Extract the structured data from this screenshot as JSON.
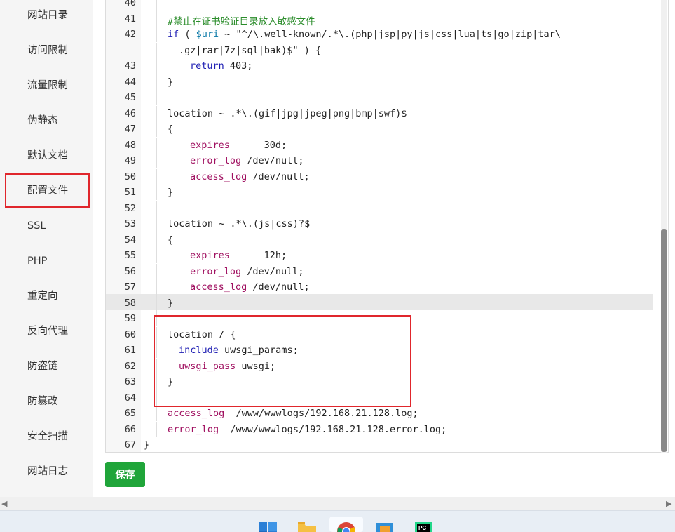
{
  "sidebar": {
    "items": [
      {
        "label": "网站目录"
      },
      {
        "label": "访问限制"
      },
      {
        "label": "流量限制"
      },
      {
        "label": "伪静态"
      },
      {
        "label": "默认文档"
      },
      {
        "label": "配置文件",
        "active": true
      },
      {
        "label": "SSL"
      },
      {
        "label": "PHP"
      },
      {
        "label": "重定向"
      },
      {
        "label": "反向代理"
      },
      {
        "label": "防盗链"
      },
      {
        "label": "防篡改"
      },
      {
        "label": "安全扫描"
      },
      {
        "label": "网站日志"
      }
    ]
  },
  "editor": {
    "active_line": "58",
    "lines": [
      {
        "n": "40",
        "indent": 1,
        "t": [
          [
            ""
          ]
        ]
      },
      {
        "n": "41",
        "indent": 1,
        "t": [
          [
            "#禁止在证书验证目录放入敏感文件",
            "#2a8c2a"
          ]
        ]
      },
      {
        "n": "42",
        "indent": 1,
        "t": [
          [
            "if",
            "#1f1fb3"
          ],
          [
            " ( ",
            "#222"
          ],
          [
            "$uri",
            "#0d7aa8"
          ],
          [
            " ~ \"^/\\.well-known/.*\\.(php|jsp|py|js|css|lua|ts|go|zip|tar\\",
            "#222"
          ]
        ]
      },
      {
        "n": "",
        "indent": 1,
        "cont": true,
        "t": [
          [
            ".gz|rar|7z|sql|bak)$\" ) {",
            "#222"
          ]
        ]
      },
      {
        "n": "43",
        "indent": 3,
        "t": [
          [
            "return",
            "#1f1fb3"
          ],
          [
            " 403;",
            "#222"
          ]
        ]
      },
      {
        "n": "44",
        "indent": 1,
        "t": [
          [
            "}",
            "#222"
          ]
        ]
      },
      {
        "n": "45",
        "indent": 1,
        "t": [
          [
            ""
          ]
        ]
      },
      {
        "n": "46",
        "indent": 1,
        "t": [
          [
            "location ~ .*\\.(gif|jpg|jpeg|png|bmp|swf)$",
            "#222"
          ]
        ]
      },
      {
        "n": "47",
        "indent": 1,
        "t": [
          [
            "{",
            "#222"
          ]
        ]
      },
      {
        "n": "48",
        "indent": 3,
        "t": [
          [
            "expires",
            "#a01060"
          ],
          [
            "      30d;",
            "#222"
          ]
        ]
      },
      {
        "n": "49",
        "indent": 3,
        "t": [
          [
            "error_log",
            "#a01060"
          ],
          [
            " /dev/null;",
            "#222"
          ]
        ]
      },
      {
        "n": "50",
        "indent": 3,
        "t": [
          [
            "access_log",
            "#a01060"
          ],
          [
            " /dev/null;",
            "#222"
          ]
        ]
      },
      {
        "n": "51",
        "indent": 1,
        "t": [
          [
            "}",
            "#222"
          ]
        ]
      },
      {
        "n": "52",
        "indent": 1,
        "t": [
          [
            ""
          ]
        ]
      },
      {
        "n": "53",
        "indent": 1,
        "t": [
          [
            "location ~ .*\\.(js|css)?$",
            "#222"
          ]
        ]
      },
      {
        "n": "54",
        "indent": 1,
        "t": [
          [
            "{",
            "#222"
          ]
        ]
      },
      {
        "n": "55",
        "indent": 3,
        "t": [
          [
            "expires",
            "#a01060"
          ],
          [
            "      12h;",
            "#222"
          ]
        ]
      },
      {
        "n": "56",
        "indent": 3,
        "t": [
          [
            "error_log",
            "#a01060"
          ],
          [
            " /dev/null;",
            "#222"
          ]
        ]
      },
      {
        "n": "57",
        "indent": 3,
        "t": [
          [
            "access_log",
            "#a01060"
          ],
          [
            " /dev/null;",
            "#222"
          ]
        ]
      },
      {
        "n": "58",
        "indent": 1,
        "t": [
          [
            "}",
            "#222"
          ]
        ]
      },
      {
        "n": "59",
        "indent": 1,
        "t": [
          [
            ""
          ]
        ]
      },
      {
        "n": "60",
        "indent": 1,
        "t": [
          [
            "location / {",
            "#222"
          ]
        ]
      },
      {
        "n": "61",
        "indent": 2,
        "t": [
          [
            "include",
            "#1f1fb3"
          ],
          [
            " uwsgi_params;",
            "#222"
          ]
        ]
      },
      {
        "n": "62",
        "indent": 2,
        "t": [
          [
            "uwsgi_pass",
            "#a01060"
          ],
          [
            " uwsgi;",
            "#222"
          ]
        ]
      },
      {
        "n": "63",
        "indent": 1,
        "t": [
          [
            "}",
            "#222"
          ]
        ]
      },
      {
        "n": "64",
        "indent": 1,
        "t": [
          [
            ""
          ]
        ]
      },
      {
        "n": "65",
        "indent": 1,
        "t": [
          [
            "access_log",
            "#a01060"
          ],
          [
            "  /www/wwwlogs/192.168.21.128.log;",
            "#222"
          ]
        ]
      },
      {
        "n": "66",
        "indent": 1,
        "t": [
          [
            "error_log",
            "#a01060"
          ],
          [
            "  /www/wwwlogs/192.168.21.128.error.log;",
            "#222"
          ]
        ]
      },
      {
        "n": "67",
        "indent": 0,
        "t": [
          [
            "}",
            "#222"
          ]
        ]
      }
    ]
  },
  "save_label": "保存",
  "colors": {
    "accent": "#20a53a",
    "highlight_border": "#e0262c",
    "keyword": "#1f1fb3",
    "directive": "#a01060",
    "comment": "#2a8c2a",
    "variable": "#0d7aa8"
  },
  "taskbar": {
    "icons": [
      {
        "name": "windows-start-icon"
      },
      {
        "name": "file-explorer-icon"
      },
      {
        "name": "chrome-browser-icon",
        "active": true
      },
      {
        "name": "app-package-icon"
      },
      {
        "name": "pycharm-icon",
        "label": "PC"
      }
    ]
  }
}
